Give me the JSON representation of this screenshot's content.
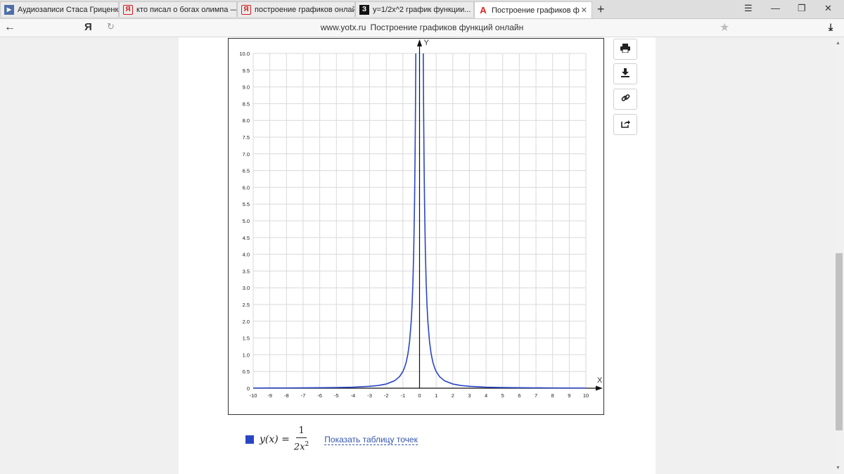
{
  "browser": {
    "tabs": [
      {
        "title": "Аудиозаписи Стаса Гриценк",
        "favicon": "play-icon",
        "active": false
      },
      {
        "title": "кто писал о богах олимпа —",
        "favicon": "yandex-icon",
        "active": false
      },
      {
        "title": "построение графиков онлай",
        "favicon": "yandex-icon",
        "active": false
      },
      {
        "title": "y=1/2x^2 график функции...",
        "favicon": "znanija-icon",
        "active": false
      },
      {
        "title": "Построение графиков ф",
        "favicon": "yotx-icon",
        "active": true
      }
    ],
    "new_tab": "+",
    "window_controls": {
      "menu": "☰",
      "minimize": "—",
      "restore": "❐",
      "close": "✕"
    },
    "back": "←",
    "yandex_logo": "Я",
    "reload": "↻",
    "address": {
      "domain": "www.yotx.ru",
      "title": "Построение графиков функций онлайн"
    },
    "bookmark": "★",
    "downloads": "⤓"
  },
  "sidebar_buttons": [
    {
      "name": "print-icon",
      "glyph": "🖶"
    },
    {
      "name": "download-icon",
      "glyph": "⤓"
    },
    {
      "name": "link-icon",
      "glyph": "🔗"
    },
    {
      "name": "share-icon",
      "glyph": "↗"
    }
  ],
  "legend": {
    "color": "#2a45c4",
    "lhs": "y(x) =",
    "numerator": "1",
    "denominator": "2x",
    "exponent": "2",
    "link": "Показать таблицу точек"
  },
  "chart_data": {
    "type": "line",
    "xlabel": "X",
    "ylabel": "Y",
    "xlim": [
      -10,
      10
    ],
    "ylim": [
      0,
      10
    ],
    "x_ticks": [
      "-10",
      "-9",
      "-8",
      "-7",
      "-6",
      "-5",
      "-4",
      "-3",
      "-2",
      "-1",
      "0",
      "1",
      "2",
      "3",
      "4",
      "5",
      "6",
      "7",
      "8",
      "9",
      "10"
    ],
    "y_ticks": [
      "0",
      "0.5",
      "1.0",
      "1.5",
      "2.0",
      "2.5",
      "3.0",
      "3.5",
      "4.0",
      "4.5",
      "5.0",
      "5.5",
      "6.0",
      "6.5",
      "7.0",
      "7.5",
      "8.0",
      "8.5",
      "9.0",
      "9.5",
      "10.0"
    ],
    "grid": true,
    "series_color": "#2a45c4",
    "series": [
      {
        "x": [
          -10,
          -8,
          -6,
          -5,
          -4,
          -3,
          -2.5,
          -2,
          -1.5,
          -1.2,
          -1,
          -0.9,
          -0.8,
          -0.7,
          -0.6,
          -0.5,
          -0.45,
          -0.4,
          -0.35,
          -0.3,
          -0.27,
          -0.25,
          -0.23,
          -0.224
        ],
        "y": [
          0.005,
          0.0078,
          0.0139,
          0.02,
          0.031,
          0.056,
          0.08,
          0.125,
          0.222,
          0.347,
          0.5,
          0.617,
          0.781,
          1.02,
          1.389,
          2.0,
          2.469,
          3.125,
          4.082,
          5.556,
          6.859,
          8.0,
          9.452,
          10.0
        ]
      },
      {
        "x": [
          0.224,
          0.23,
          0.25,
          0.27,
          0.3,
          0.35,
          0.4,
          0.45,
          0.5,
          0.6,
          0.7,
          0.8,
          0.9,
          1,
          1.2,
          1.5,
          2,
          2.5,
          3,
          4,
          5,
          6,
          8,
          10
        ],
        "y": [
          10.0,
          9.452,
          8.0,
          6.859,
          5.556,
          4.082,
          3.125,
          2.469,
          2.0,
          1.389,
          1.02,
          0.781,
          0.617,
          0.5,
          0.347,
          0.222,
          0.125,
          0.08,
          0.056,
          0.031,
          0.02,
          0.0139,
          0.0078,
          0.005
        ]
      }
    ]
  }
}
